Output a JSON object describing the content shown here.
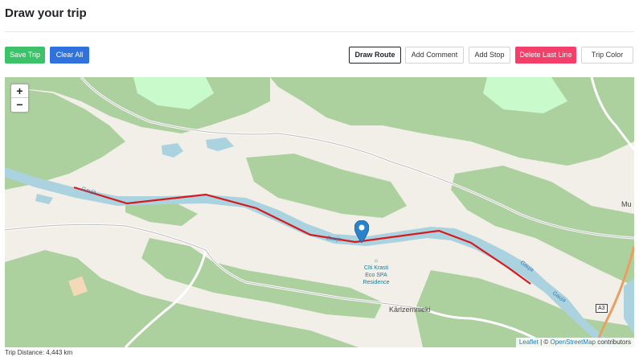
{
  "page": {
    "title": "Draw your trip"
  },
  "toolbar": {
    "save_trip": "Save Trip",
    "clear_all": "Clear All",
    "draw_route": "Draw Route",
    "add_comment": "Add Comment",
    "add_stop": "Add Stop",
    "delete_last_line": "Delete Last Line",
    "trip_color": "Trip Color"
  },
  "map": {
    "zoom_in": "+",
    "zoom_out": "−",
    "labels": {
      "spa_line1": "Cīti Krasti",
      "spa_line2": "Eco SPA",
      "spa_line3": "Residence",
      "karlzemnieki": "Kārlzemnieki",
      "mu": "Mu",
      "road_shield": "A3",
      "river_gauja_1": "Gauja",
      "river_gauja_2": "Gauja",
      "river_gauja_3": "Gauja",
      "river_gauja_4": "Gauja"
    },
    "attribution": {
      "leaflet": "Leaflet",
      "separator": " | © ",
      "osm": "OpenStreetMap",
      "contributors": " contributors"
    },
    "colors": {
      "route": "#d7191c",
      "marker": "#2b82cb",
      "forest": "#add19e",
      "water": "#aad3df",
      "land": "#f2efe9"
    },
    "icons": [
      "map-marker-icon",
      "spa-icon"
    ]
  },
  "footer": {
    "trip_distance": "Trip Distance: 4,443 km"
  }
}
